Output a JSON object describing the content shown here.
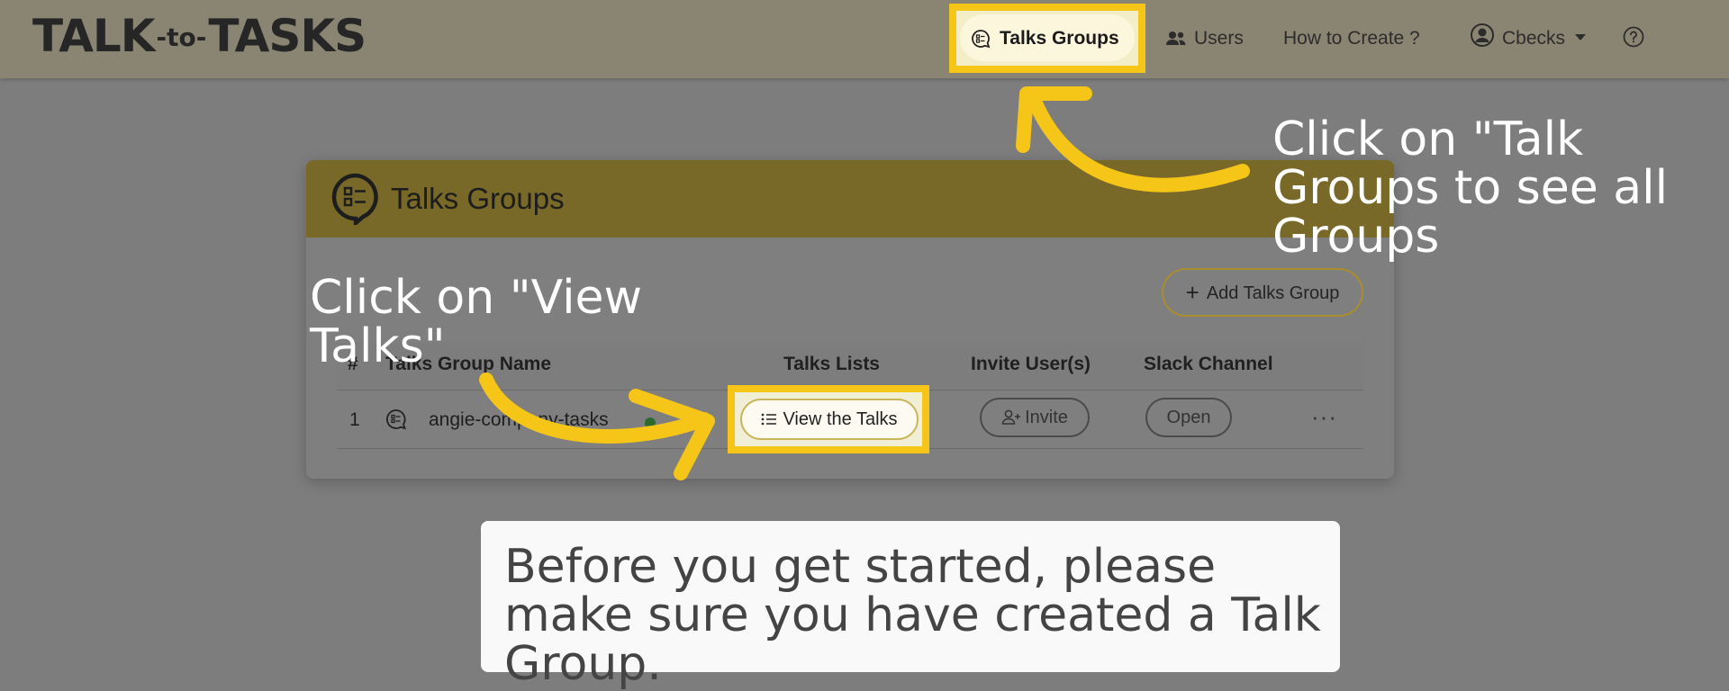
{
  "brand": {
    "left": "TALK",
    "middle": "-to-",
    "right": "TASKS"
  },
  "nav": {
    "active_label": "Talks Groups",
    "users_label": "Users",
    "how_to_label": "How to Create ?",
    "profile_label": "Cbecks",
    "help_icon": "question-circle-icon"
  },
  "card": {
    "title": "Talks Groups",
    "add_button_label": "Add Talks Group",
    "table": {
      "headers": [
        "#",
        "Talks Group Name",
        "Talks Lists",
        "Invite User(s)",
        "Slack Channel"
      ],
      "rows": [
        {
          "index": "1",
          "name": "angie-company-tasks",
          "view_label": "View the Talks",
          "invite_label": "Invite",
          "open_label": "Open"
        }
      ]
    }
  },
  "annotations": {
    "talk_groups": "Click on \"Talk Groups to see all Groups",
    "view_talks": "Click on \"View Talks\""
  },
  "notice": {
    "text": "Before you get started, please make sure you have created a Talk Group."
  },
  "colors": {
    "highlight": "#f5c518",
    "card_header": "#786928",
    "status_online": "#2d6a2d"
  }
}
